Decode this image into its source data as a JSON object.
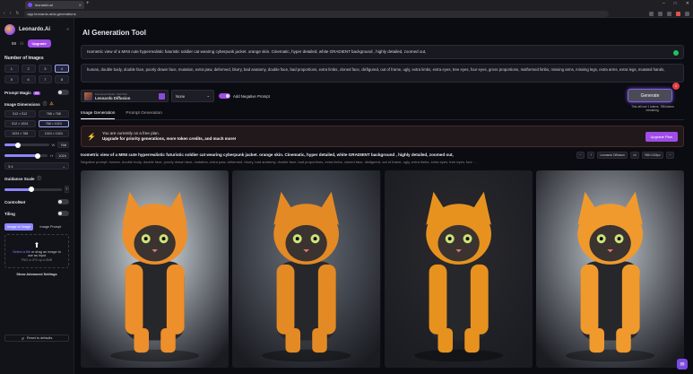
{
  "browser": {
    "tab_title": "leonardo.ai",
    "url": "app.leonardo.ai/ai-generations",
    "new_tab": "+"
  },
  "sidebar": {
    "logo": "Leonardo.Ai",
    "tokens": "88",
    "upgrade": "Upgrade",
    "num_images_title": "Number of Images",
    "num_images": [
      "1",
      "2",
      "3",
      "4",
      "5",
      "6",
      "7",
      "8"
    ],
    "num_selected": 3,
    "prompt_magic": "Prompt Magic",
    "prompt_magic_badge": "V2",
    "dimensions_title": "Image Dimensions",
    "dimensions": [
      "512 × 512",
      "768 × 768",
      "512 × 1024",
      "768 × 1024",
      "1024 × 768",
      "1024 × 1024"
    ],
    "dim_selected": 3,
    "w_label": "W",
    "w_value": "768",
    "h_label": "H",
    "h_value": "1024",
    "ratio": "3:4",
    "guidance_title": "Guidance Scale",
    "guidance_value": "7",
    "controlnet": "ControlNet",
    "tiling": "Tiling",
    "img_tab_1": "Image to Image",
    "img_tab_2": "Image Prompt",
    "drop_link": "Select a file",
    "drop_text": "or drag an image to use as input",
    "drop_sub": "PNG or JPG up to 5MB",
    "advanced": "Show Advanced Settings",
    "reset": "Reset to defaults"
  },
  "main": {
    "title": "AI Generation Tool",
    "prompt": "Isometric view of a MINI cute hyperrealistic futuristic soldier cat wearing cyberpunk jacket. orange skin. Cinematic, hyper detailed, white GRADIENT background , highly detailed, zoomed out,",
    "negative_prompt": "human, double body, double face, poorly drawn face, mutation, extra paw, deformed, blurry, bad anatomy, double face, bad proportions, extra limbs, cloned face, disfigured, out of frame, ugly, extra limbs, extra eyes, tree eyes, four eyes, gross proportions, malformed limbs, missing arms, missing legs, extra arms, extra legs, mutated hands,",
    "model_key": "Finetuned Model",
    "model_size": "512×512",
    "model_name": "Leonardo Diffusion",
    "style": "None",
    "neg_toggle": "Add Negative Prompt",
    "generate": "Generate",
    "generate_badge": "1",
    "generate_note": "This will use 1 tokens. 788 tokens remaining.",
    "tabs": [
      "Image Generation",
      "Prompt Generation"
    ],
    "banner_line1": "You are currently on a free plan.",
    "banner_line2": "Upgrade for priority generations, more token credits, and much more!",
    "banner_button": "Upgrade Plan",
    "result_prompt": "Isometric view of a MINI cute hyperrealistic futuristic soldier cat wearing cyberpunk jacket. orange skin. Cinematic, hyper detailed, white GRADIENT background , highly detailed, zoomed out,",
    "result_negative": "Negative prompt: human, double body, double face, poorly drawn face, mutation, extra paw, deformed, blurry, bad anatomy, double face, bad proportions, extra limbs, cloned face, disfigured, out of frame, ugly, extra limbs, extra eyes, tree eyes, four …",
    "result_model": "Leonardo Diffusion",
    "result_count": "×4",
    "result_size": "768×1024px"
  }
}
